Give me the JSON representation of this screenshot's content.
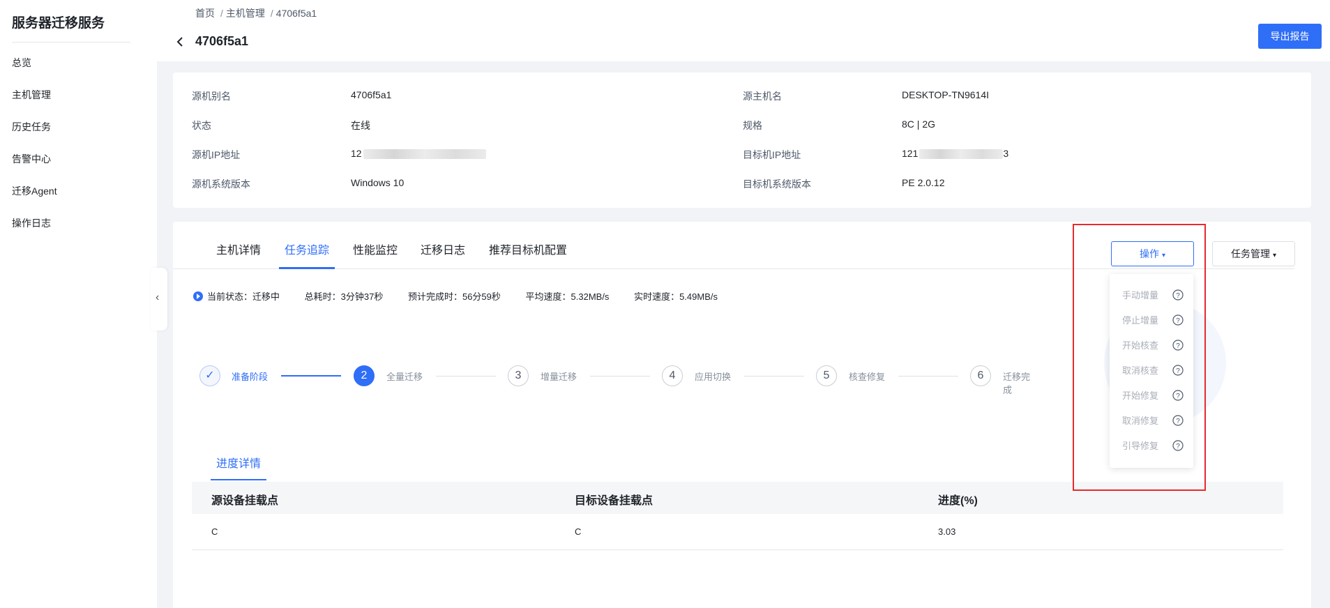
{
  "sidebar": {
    "app_title": "服务器迁移服务",
    "items": [
      {
        "label": "总览"
      },
      {
        "label": "主机管理"
      },
      {
        "label": "历史任务"
      },
      {
        "label": "告警中心"
      },
      {
        "label": "迁移Agent"
      },
      {
        "label": "操作日志"
      }
    ]
  },
  "header": {
    "breadcrumb": [
      "首页",
      "主机管理",
      "4706f5a1"
    ],
    "breadcrumb_separator": "/",
    "title": "4706f5a1",
    "export_label": "导出报告"
  },
  "info": {
    "rows": [
      {
        "k1": "源机别名",
        "v1": "4706f5a1",
        "k2": "源主机名",
        "v2": "DESKTOP-TN9614I"
      },
      {
        "k1": "状态",
        "v1": "在线",
        "k2": "规格",
        "v2": "8C | 2G"
      },
      {
        "k1": "源机IP地址",
        "v1": "12",
        "k2": "目标机IP地址",
        "v2": "121",
        "v2_suffix": "3"
      },
      {
        "k1": "源机系统版本",
        "v1": "Windows 10",
        "k2": "目标机系统版本",
        "v2": "PE 2.0.12"
      }
    ]
  },
  "tabs": [
    "主机详情",
    "任务追踪",
    "性能监控",
    "迁移日志",
    "推荐目标机配置"
  ],
  "active_tab": "任务追踪",
  "actions": {
    "operate_label": "操作",
    "task_mgmt_label": "任务管理"
  },
  "status": {
    "current": "当前状态：迁移中",
    "elapsed": "总耗时：3分钟37秒",
    "eta": "预计完成时：56分59秒",
    "avg_speed": "平均速度：5.32MB/s",
    "realtime_speed": "实时速度：5.49MB/s"
  },
  "steps": [
    {
      "num": "✓",
      "label": "准备阶段",
      "state": "done"
    },
    {
      "num": "2",
      "label": "全量迁移",
      "state": "current"
    },
    {
      "num": "3",
      "label": "增量迁移",
      "state": "pending"
    },
    {
      "num": "4",
      "label": "应用切换",
      "state": "pending"
    },
    {
      "num": "5",
      "label": "核查修复",
      "state": "pending"
    },
    {
      "num": "6",
      "label": "迁移完成",
      "state": "pending"
    }
  ],
  "progress": {
    "tab_label": "进度详情",
    "columns": [
      "源设备挂载点",
      "目标设备挂载点",
      "进度(%)"
    ],
    "rows": [
      {
        "src": "C",
        "dst": "C",
        "pct": "3.03"
      }
    ]
  },
  "dropdown": {
    "items": [
      "手动增量",
      "停止增量",
      "开始核查",
      "取消核查",
      "开始修复",
      "取消修复",
      "引导修复"
    ]
  },
  "colors": {
    "accent": "#2f6ef7",
    "highlight": "#e8292e"
  }
}
